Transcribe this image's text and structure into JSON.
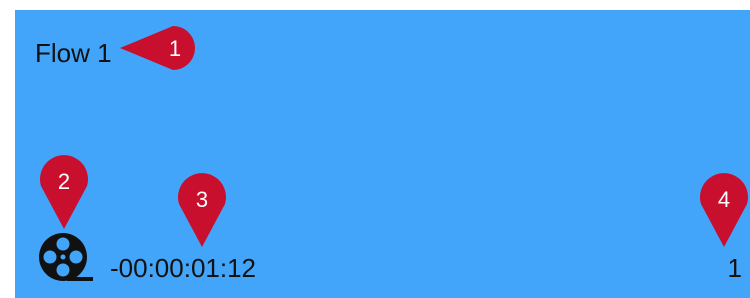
{
  "flow": {
    "title": "Flow 1",
    "timecode": "-00:00:01:12",
    "count": "1"
  },
  "icons": {
    "reel": "film-reel-icon"
  },
  "callouts": [
    "1",
    "2",
    "3",
    "4"
  ],
  "colors": {
    "panel_background": "#42a5f9",
    "callout": "#c8102e",
    "text": "#111111"
  }
}
